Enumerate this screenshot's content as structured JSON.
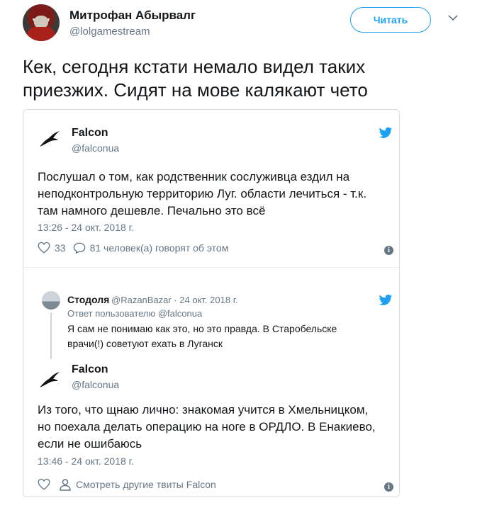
{
  "author": {
    "name": "Митрофан Абырвалг",
    "handle": "@lolgamestream",
    "follow_label": "Читать"
  },
  "tweet": {
    "text_line1": "Кек, сегодня кстати немало видел таких",
    "text_line2": "приезжих. Сидят на мове калякают чето"
  },
  "quoted": {
    "first": {
      "name": "Falcon",
      "handle": "@falconua",
      "line1": "Послушал о том, как родственник сослуживца ездил на",
      "line2": "неподконтрольную территорию Луг. области лечиться - т.к.",
      "line3": "там намного дешевле. Печально это всё",
      "time": "13:26 - 24 окт. 2018 г.",
      "likes": "33",
      "replies_label": "81 человек(а) говорят об этом"
    },
    "reply": {
      "name": "Стодоля",
      "meta": "@RazanBazar · 24 окт. 2018 г.",
      "reply_to": "Ответ пользователю @falconua",
      "line1": "Я сам не понимаю как это, но это правда. В Старобельске",
      "line2": "врачи(!) советуют ехать в Луганск"
    },
    "second": {
      "name": "Falcon",
      "handle": "@falconua",
      "line1": "Из того, что щнаю лично: знакомая учится в Хмельницком,",
      "line2": "но поехала делать операцию  на ноге в ОРДЛО. В Енакиево,",
      "line3": "если не ошибаюсь",
      "time": "13:46 - 24 окт. 2018 г.",
      "more_label": "Смотреть другие твиты Falcon"
    }
  },
  "colors": {
    "accent": "#1da1f2",
    "muted": "#657786",
    "text": "#14171a",
    "border": "#d5dde3"
  },
  "icons": [
    "avatar",
    "chevron-down-icon",
    "falcon-bird-icon",
    "twitter-logo-icon",
    "heart-icon",
    "reply-bubble-icon",
    "info-icon",
    "person-icon"
  ]
}
